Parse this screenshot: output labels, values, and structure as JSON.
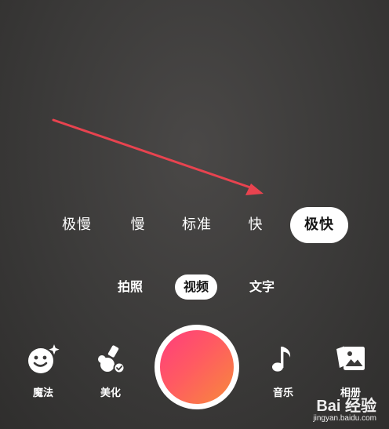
{
  "speed": {
    "options": [
      "极慢",
      "慢",
      "标准",
      "快",
      "极快"
    ],
    "selected": "极快"
  },
  "modes": {
    "items": [
      "拍照",
      "视频",
      "文字"
    ],
    "selected": "视频"
  },
  "tools": {
    "magic": {
      "label": "魔法",
      "icon": "magic-face-icon"
    },
    "beauty": {
      "label": "美化",
      "icon": "beauty-icon"
    },
    "music": {
      "label": "音乐",
      "icon": "music-note-icon"
    },
    "album": {
      "label": "相册",
      "icon": "album-icon"
    }
  },
  "annotation": {
    "color": "#e8434f"
  },
  "record": {
    "colors": [
      "#ff3d7d",
      "#f78a3b"
    ]
  },
  "watermark": {
    "logo": "Bai 经验",
    "url": "jingyan.baidu.com"
  }
}
